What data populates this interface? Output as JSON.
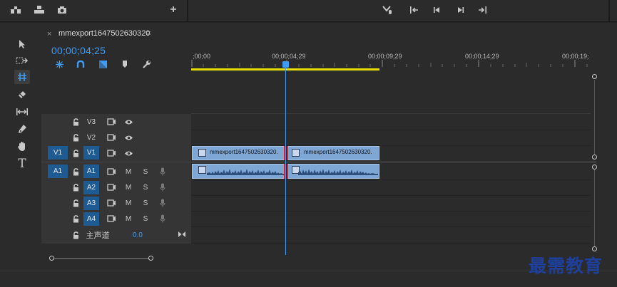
{
  "sequence": {
    "tab_close": "×",
    "tab_title": "mmexport1647502630320",
    "tab_menu": "≡",
    "timecode": "00;00;04;25"
  },
  "ruler": {
    "labels": [
      ";00;00",
      "00;00;04;29",
      "00;00;09;29",
      "00;00;14;29",
      "00;00;19;"
    ]
  },
  "tracks": {
    "video": [
      {
        "label": "V3",
        "source": ""
      },
      {
        "label": "V2",
        "source": ""
      },
      {
        "label": "V1",
        "source": "V1"
      }
    ],
    "audio": [
      {
        "label": "A1",
        "source": "A1"
      },
      {
        "label": "A2",
        "source": ""
      },
      {
        "label": "A3",
        "source": ""
      },
      {
        "label": "A4",
        "source": ""
      }
    ],
    "mute": "M",
    "solo": "S",
    "master_label": "主声道",
    "master_value": "0.0"
  },
  "clips": {
    "video_1": "mmexport1647502630320.",
    "video_2": "mmexport1647502630320."
  },
  "watermark": "最需教育",
  "colors": {
    "accent": "#3f9cf5",
    "clip": "#7fa7d6",
    "playhead": "#3f9cf5",
    "edit_point": "#d9252a",
    "work_area": "#e8e000",
    "target": "#1f5b93"
  }
}
